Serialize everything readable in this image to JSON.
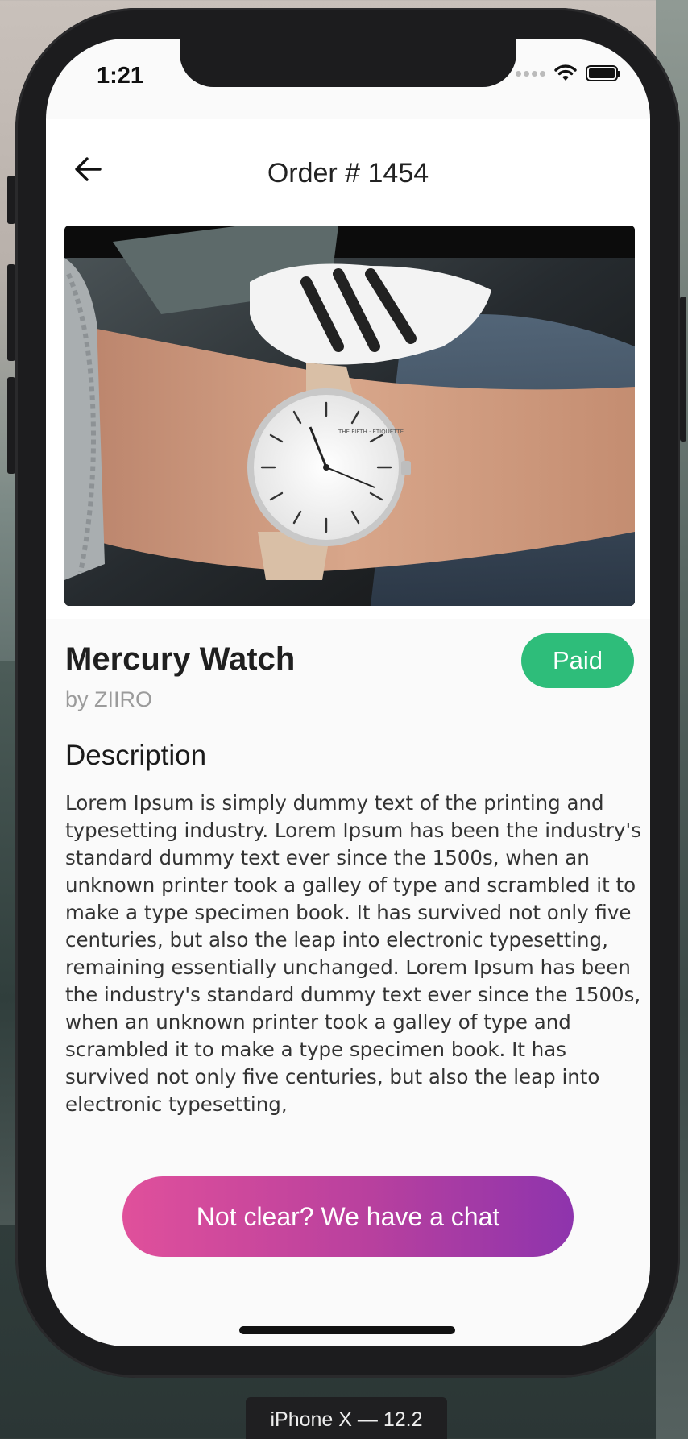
{
  "status_bar": {
    "time": "1:21"
  },
  "header": {
    "title": "Order # 1454"
  },
  "product": {
    "name": "Mercury Watch",
    "brand": "by ZIIRO",
    "status": "Paid",
    "status_color": "#2ebd7a",
    "image_watch_text": "THE FIFTH · ETIQUETTE"
  },
  "description": {
    "heading": "Description",
    "body": "Lorem Ipsum is simply dummy text of the printing and typesetting industry. Lorem Ipsum has been the industry's standard dummy text ever since the 1500s, when an unknown printer took a galley of type and scrambled it to make a type specimen book. It has survived not only five centuries, but also the leap into electronic typesetting, remaining essentially unchanged. Lorem Ipsum has been the industry's standard dummy text ever since the 1500s, when an unknown printer took a galley of type and scrambled it to make a type specimen book. It has survived not only five centuries, but also the leap into electronic typesetting,"
  },
  "chat_button": {
    "label": "Not clear? We have a chat",
    "gradient_start": "#e0509b",
    "gradient_end": "#8e34ad"
  },
  "simulator": {
    "device_label": "iPhone X — 12.2"
  },
  "icons": {
    "back": "arrow-left-icon",
    "wifi": "wifi-icon",
    "battery": "battery-icon",
    "signal": "signal-icon"
  }
}
